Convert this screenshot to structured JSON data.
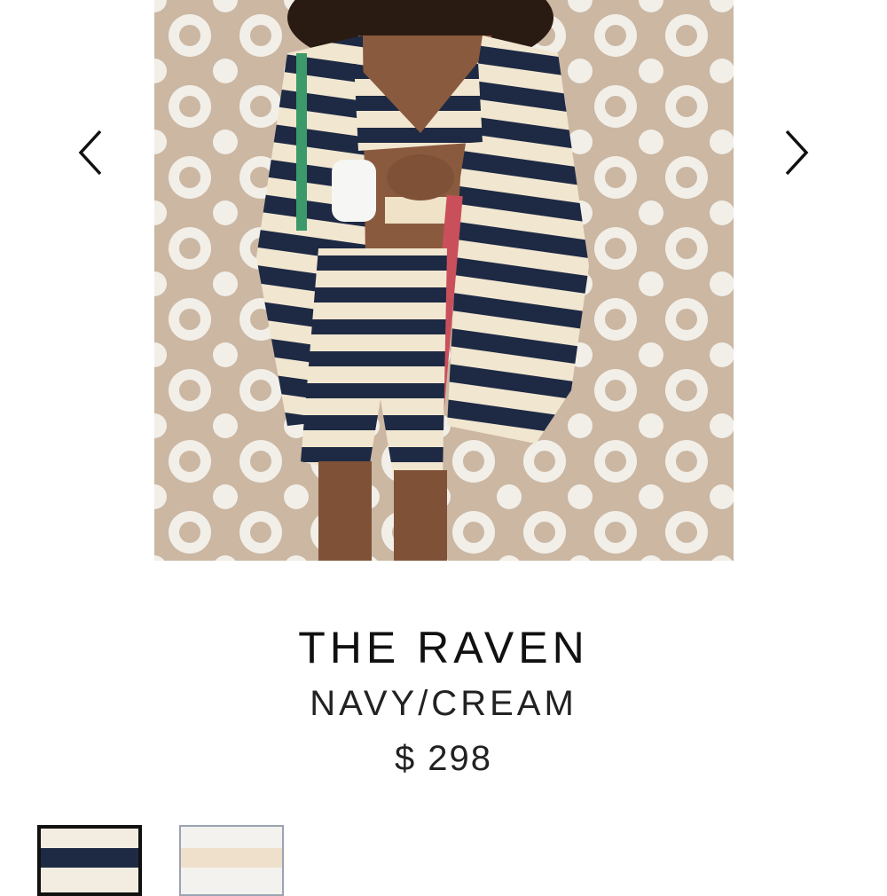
{
  "gallery": {
    "prev_icon": "chevron-left-icon",
    "next_icon": "chevron-right-icon"
  },
  "product": {
    "name": "THE RAVEN",
    "color": "NAVY/CREAM",
    "price": "$ 298"
  },
  "swatches": [
    {
      "name": "navy-cream",
      "selected": true,
      "colors": {
        "base": "#f3ece0",
        "stripe": "#1e2a44"
      }
    },
    {
      "name": "cream",
      "selected": false,
      "colors": {
        "base": "#f4f2ee",
        "stripe": "#efe0cc"
      }
    }
  ],
  "colors": {
    "navy": "#1e2a44",
    "cream": "#f1e6d0",
    "stone": "#c9b49f"
  }
}
